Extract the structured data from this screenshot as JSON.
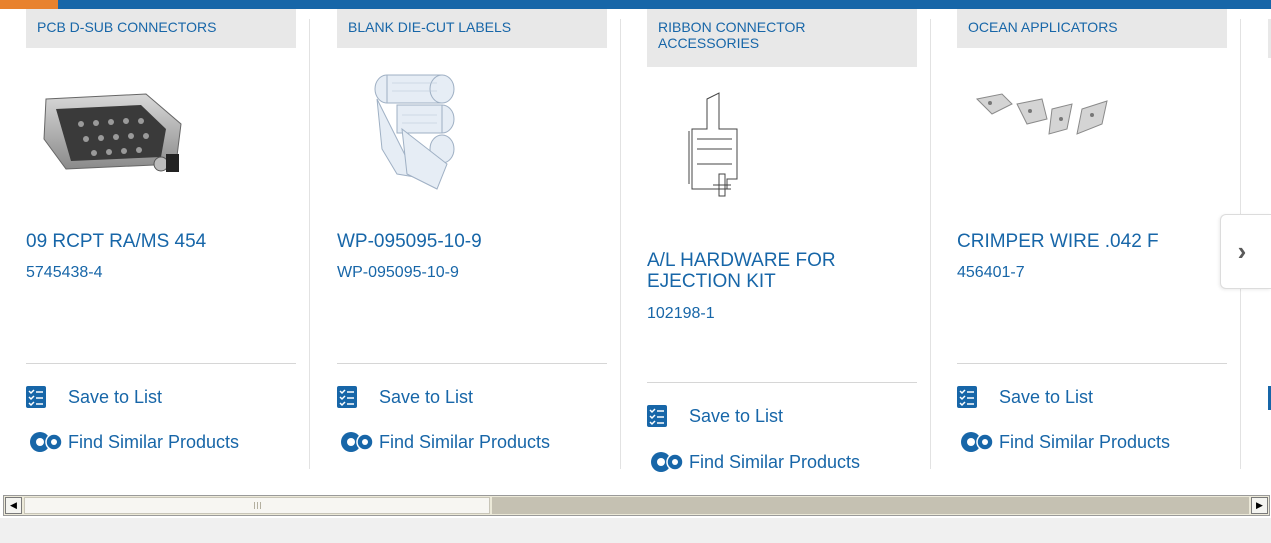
{
  "carousel": {
    "cards": [
      {
        "category": "PCB D-SUB CONNECTORS",
        "title": "09 RCPT RA/MS 454",
        "part_number": "5745438-4",
        "save_label": "Save to List",
        "similar_label": "Find Similar Products",
        "image": "d-sub-connector-photo"
      },
      {
        "category": "BLANK DIE-CUT LABELS",
        "title": "WP-095095-10-9",
        "part_number": "WP-095095-10-9",
        "save_label": "Save to List",
        "similar_label": "Find Similar Products",
        "image": "label-rolls-photo"
      },
      {
        "category": "RIBBON CONNECTOR ACCESSORIES",
        "title": "A/L HARDWARE FOR EJECTION KIT",
        "part_number": "102198-1",
        "save_label": "Save to List",
        "similar_label": "Find Similar Products",
        "image": "hardware-line-drawing"
      },
      {
        "category": "OCEAN APPLICATORS",
        "title": "CRIMPER WIRE .042 F",
        "part_number": "456401-7",
        "save_label": "Save to List",
        "similar_label": "Find Similar Products",
        "image": "crimper-parts-photo"
      }
    ],
    "next_button": "›"
  },
  "colors": {
    "brand_blue": "#1766a8",
    "accent_orange": "#e8822e",
    "tag_bg": "#e8e8e8"
  },
  "icons": {
    "save": "checklist-icon",
    "similar": "gears-icon",
    "next": "chevron-right-icon"
  }
}
